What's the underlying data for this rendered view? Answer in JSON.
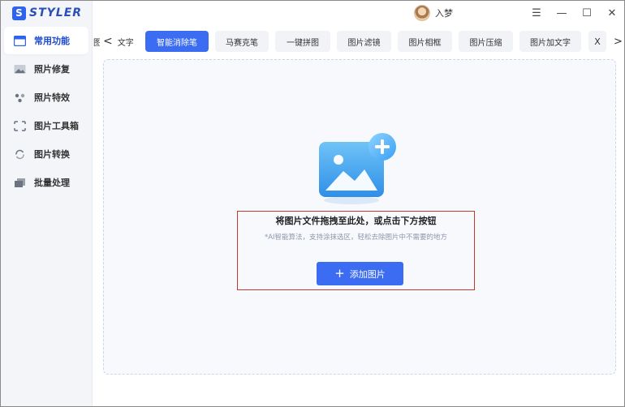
{
  "app": {
    "logo_letter": "S",
    "logo_text": "STYLER"
  },
  "user": {
    "name": "入梦"
  },
  "window": {
    "menu_icon": "☰",
    "minimize_icon": "—",
    "maximize_icon": "☐",
    "close_icon": "✕"
  },
  "sidebar": {
    "items": [
      {
        "label": "常用功能",
        "icon": "window-icon",
        "active": true
      },
      {
        "label": "照片修复",
        "icon": "photo-restore-icon"
      },
      {
        "label": "照片特效",
        "icon": "effects-icon"
      },
      {
        "label": "图片工具箱",
        "icon": "toolbox-icon"
      },
      {
        "label": "图片转换",
        "icon": "convert-icon"
      },
      {
        "label": "批量处理",
        "icon": "batch-icon"
      }
    ]
  },
  "tabs": {
    "partial_left": "图",
    "left_arrow": "<",
    "partial_label": "文字",
    "items": [
      {
        "label": "智能消除笔",
        "active": true
      },
      {
        "label": "马赛克笔"
      },
      {
        "label": "一键拼图"
      },
      {
        "label": "图片滤镜"
      },
      {
        "label": "图片相框"
      },
      {
        "label": "图片压缩"
      },
      {
        "label": "图片加文字"
      }
    ],
    "close_label": "X",
    "right_arrow": ">"
  },
  "dropzone": {
    "title": "将图片文件拖拽至此处，或点击下方按钮",
    "subtitle": "*AI智能算法，支持涂抹选区，轻松去除图片中不需要的地方",
    "button_label": "添加图片",
    "button_icon": "+"
  },
  "colors": {
    "accent": "#3b6cf2",
    "highlight": "#c0392b"
  }
}
